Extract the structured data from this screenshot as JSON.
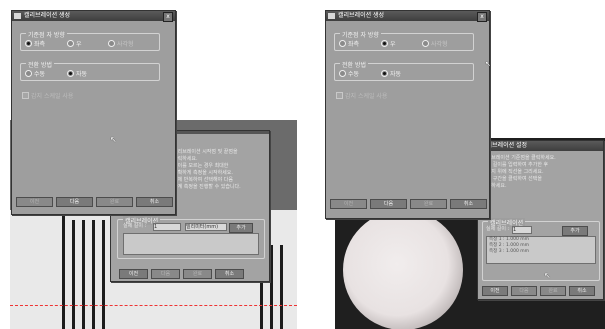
{
  "app_title": "캘리브레이션 생성",
  "close_glyph": "x",
  "left": {
    "group_edge": "기준점 자 방향",
    "edge_options": [
      "좌측",
      "우",
      "사각형"
    ],
    "group_method": "전환 방법",
    "method_options": [
      "수동",
      "자동"
    ],
    "auto_check": "감지 스케일 사용",
    "buttons": [
      "이전",
      "다음",
      "완료",
      "취소"
    ]
  },
  "right": {
    "group_edge": "기준점 자 방향",
    "edge_options": [
      "좌측",
      "우",
      "사각형"
    ],
    "group_method": "전환 방법",
    "method_options": [
      "수동",
      "자동"
    ],
    "auto_check": "감지 스케일 사용",
    "buttons": [
      "이전",
      "다음",
      "완료",
      "취소"
    ]
  },
  "overlay_left": {
    "lines": [
      "캘리브레이션 시작점 및 끝점을",
      "클릭하세요.",
      "",
      "길이를 모르는 경우 최대한",
      "정확하게 측정을 시작하세요.",
      "",
      "전체 반복하여 선택해야 다음",
      "단계 측정을 진행할 수 있습니다."
    ],
    "label_length": "실제 길이 :",
    "field_value": "1",
    "unit_value": "밀리미터(mm)",
    "add_button": "추가",
    "group_label": "캘리브레이션",
    "buttons": [
      "이전",
      "다음",
      "완료",
      "취소"
    ]
  },
  "overlay_right": {
    "title": "캘리브레이션 설정",
    "lines": [
      "캘리브레이션 기준점을 클릭하세요.",
      "",
      "측정 길이를 입력하여 추가한 후",
      "이미지 위에 직선을 그리세요.",
      "",
      "전체 구간을 클릭하여 선택을",
      "완료하세요."
    ],
    "label_length": "실제 길이 :",
    "field_value": "1",
    "add_button": "추가",
    "group_label": "캘리브레이션",
    "list_rows": [
      "측정 1 : 1.000 mm",
      "측정 2 : 1.000 mm",
      "측정 3 : 1.000 mm"
    ],
    "buttons": [
      "이전",
      "다음",
      "완료",
      "취소"
    ]
  }
}
